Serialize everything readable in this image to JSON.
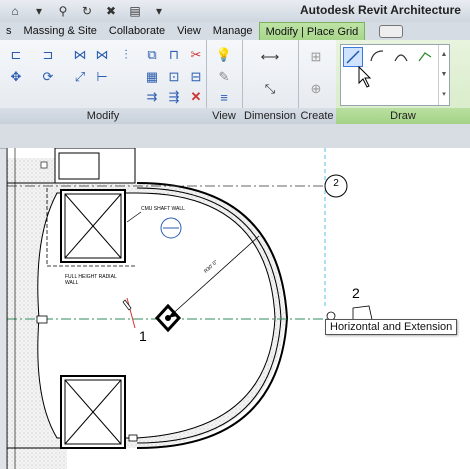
{
  "app": {
    "title": "Autodesk Revit Architecture"
  },
  "tabs": [
    {
      "label": "Massing & Site"
    },
    {
      "label": "Collaborate"
    },
    {
      "label": "View"
    },
    {
      "label": "Manage"
    },
    {
      "label": "Modify | Place Grid",
      "active": true
    }
  ],
  "ribbon": {
    "panels": [
      {
        "label": "Modify"
      },
      {
        "label": "View"
      },
      {
        "label": "Dimension"
      },
      {
        "label": "Create"
      },
      {
        "label": "Draw"
      }
    ]
  },
  "canvas": {
    "labels": {
      "cmu_shaft_wall": "CMU SHAFT WALL",
      "full_height_radial_wall": "FULL HEIGHT RADIAL\nWALL",
      "dimension_text": "R30' 0\"",
      "grid1": "1",
      "grid2_label": "2",
      "grid2_bubble": "2"
    },
    "tooltip": "Horizontal and Extension"
  },
  "colors": {
    "active_tab": "#a7d68b",
    "grid_line": "#2d8a5a",
    "cursor_red": "#d33",
    "tooltip_bg": "#ffffff"
  }
}
